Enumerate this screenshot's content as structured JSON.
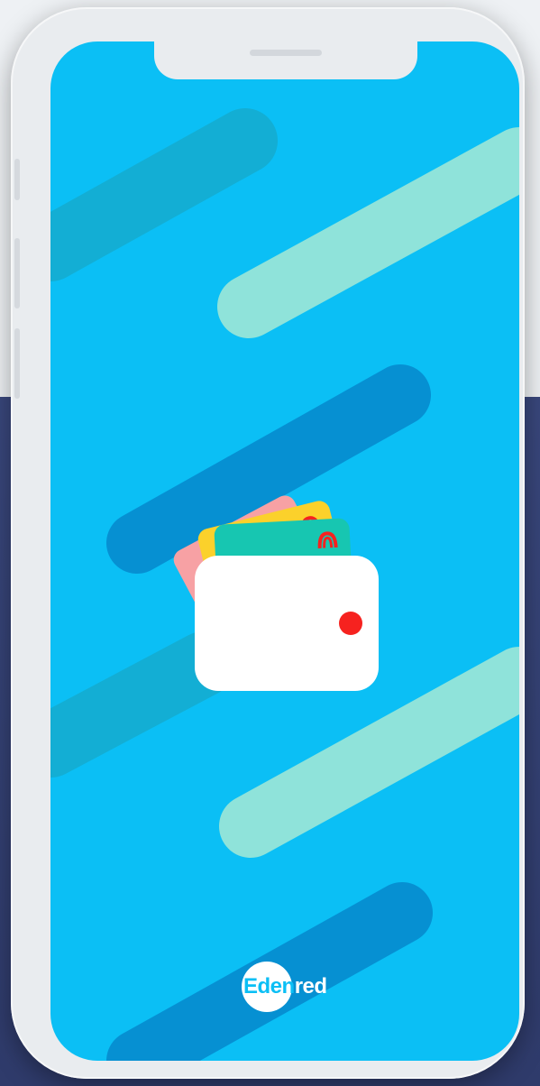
{
  "app": {
    "brand_prefix": "Eden",
    "brand_suffix": "red"
  },
  "icons": {
    "wallet": "wallet-icon",
    "cards": [
      "credit-card-icon",
      "credit-card-icon",
      "credit-card-icon"
    ]
  },
  "colors": {
    "screen_background": "#0bbff5",
    "stripe_dark": "#0690d2",
    "stripe_mint": "#8fe3da",
    "stripe_teal": "#13aed4",
    "card_pink": "#f7a1a4",
    "card_yellow": "#fbd12b",
    "card_teal": "#17c6b1",
    "wallet": "#ffffff",
    "wallet_dot": "#f6221f"
  }
}
